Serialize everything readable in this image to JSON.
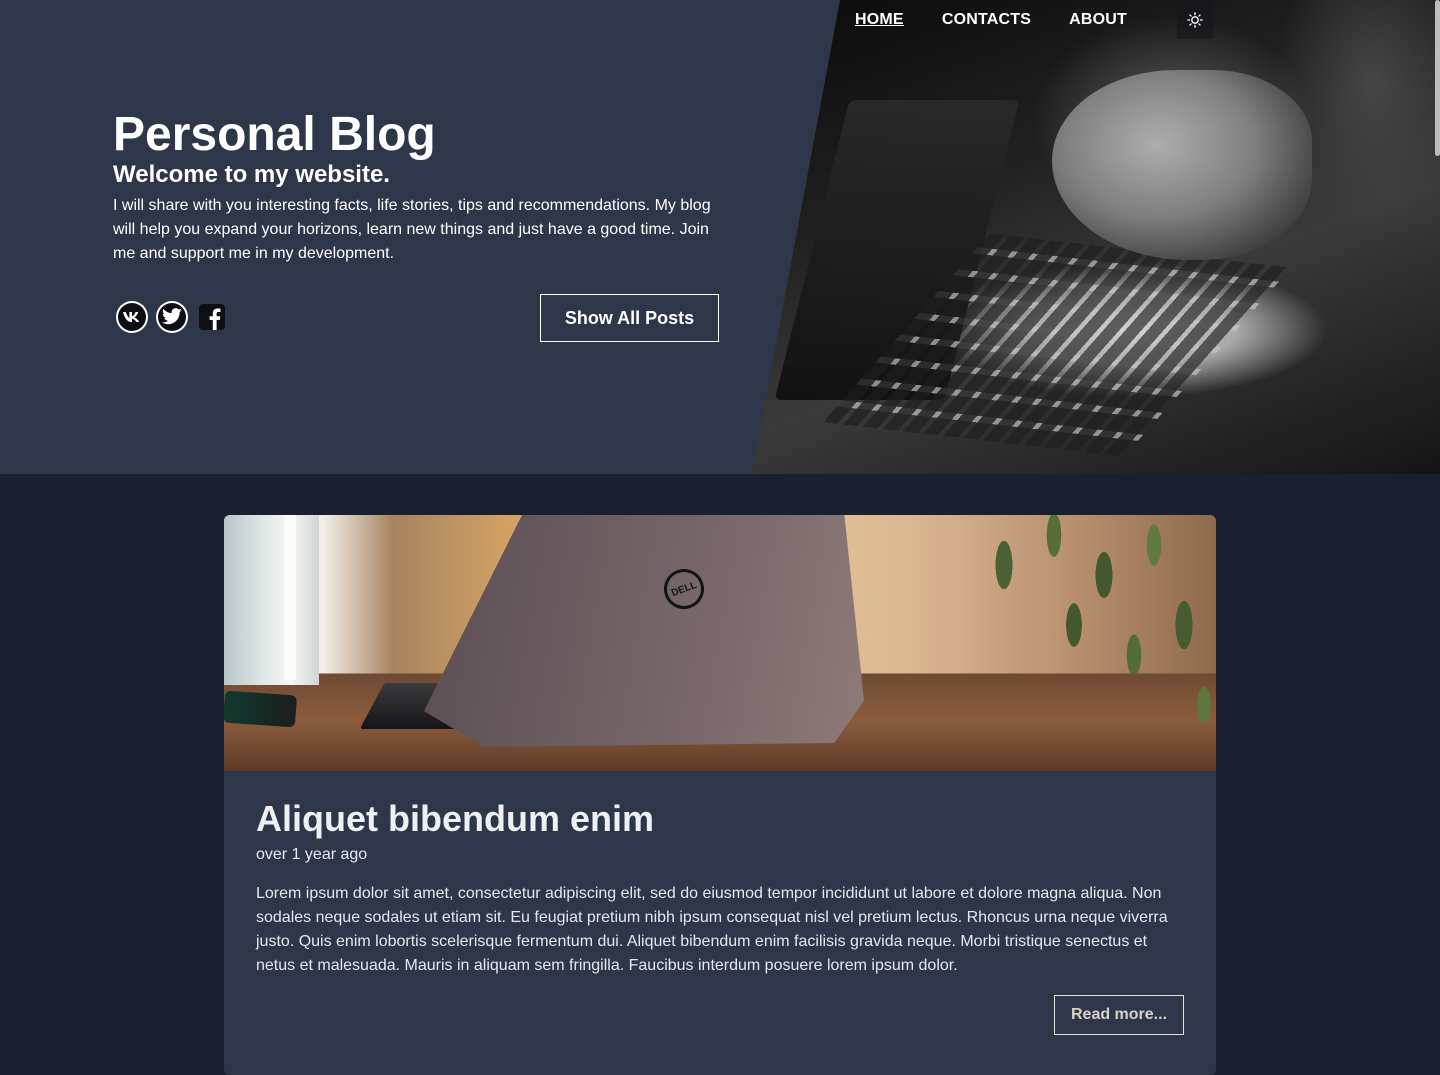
{
  "nav": {
    "items": [
      {
        "label": "HOME",
        "active": true
      },
      {
        "label": "CONTACTS",
        "active": false
      },
      {
        "label": "ABOUT",
        "active": false
      }
    ],
    "theme_toggle_icon": "sun-icon"
  },
  "hero": {
    "title": "Personal Blog",
    "subtitle": "Welcome to my website.",
    "description": "I will share with you interesting facts, life stories, tips and recommendations. My blog will help you expand your horizons, learn new things and just have a good time. Join me and support me in my development.",
    "socials": [
      {
        "name": "vk",
        "icon": "vk-icon"
      },
      {
        "name": "twitter",
        "icon": "twitter-icon"
      },
      {
        "name": "facebook",
        "icon": "facebook-icon"
      }
    ],
    "cta_label": "Show All Posts"
  },
  "post": {
    "title": "Aliquet bibendum enim",
    "date": "over 1 year ago",
    "excerpt": "Lorem ipsum dolor sit amet, consectetur adipiscing elit, sed do eiusmod tempor incididunt ut labore et dolore magna aliqua. Non sodales neque sodales ut etiam sit. Eu feugiat pretium nibh ipsum consequat nisl vel pretium lectus. Rhoncus urna neque viverra justo. Quis enim lobortis scelerisque fermentum dui. Aliquet bibendum enim facilisis gravida neque. Morbi tristique senectus et netus et malesuada. Mauris in aliquam sem fringilla. Faucibus interdum posuere lorem ipsum dolor.",
    "read_more_label": "Read more...",
    "laptop_logo_text": "DELL"
  },
  "colors": {
    "hero_bg": "#2e3649",
    "page_bg": "#1b2030",
    "card_bg": "#2e3649",
    "text": "#ffffff"
  }
}
